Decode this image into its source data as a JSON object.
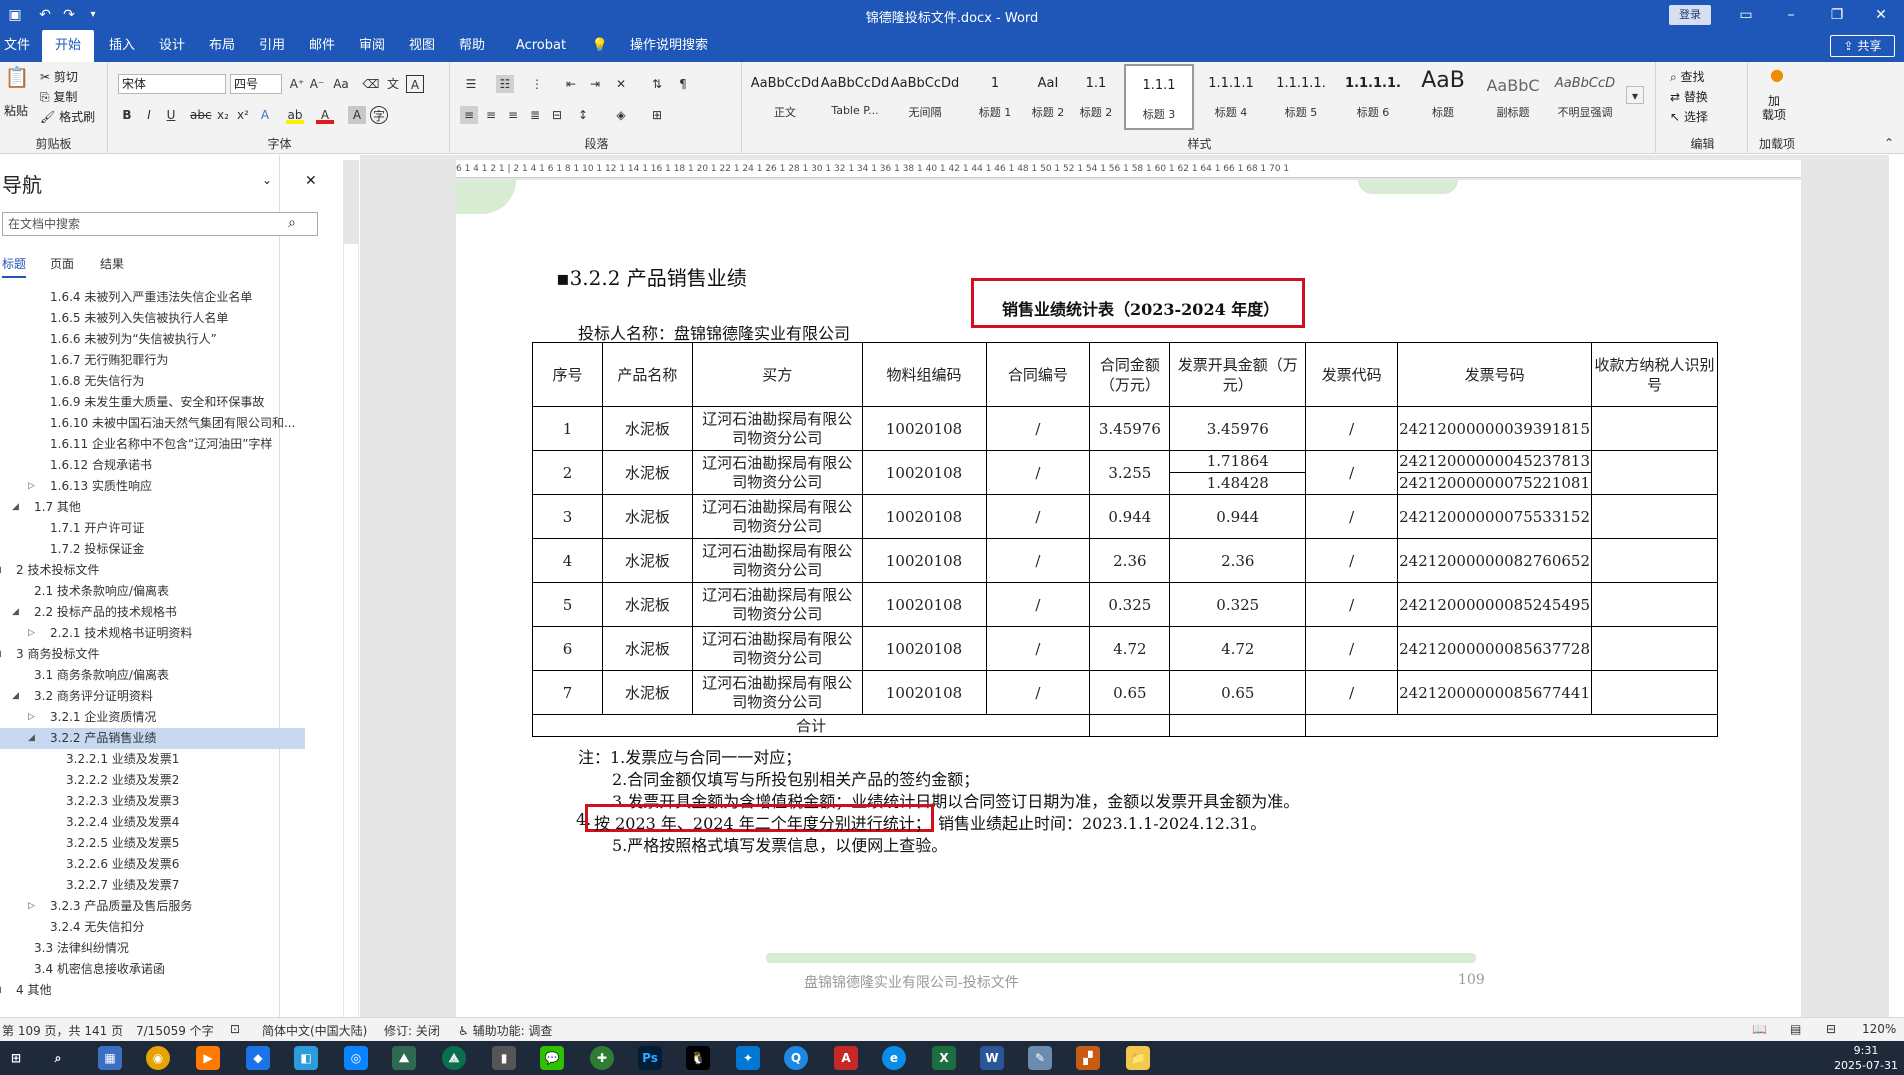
{
  "window": {
    "title": "锦德隆投标文件.docx - Word",
    "login": "登录"
  },
  "menu": {
    "tabs": [
      "文件",
      "开始",
      "插入",
      "设计",
      "布局",
      "引用",
      "邮件",
      "审阅",
      "视图",
      "帮助",
      "Acrobat",
      "操作说明搜索"
    ],
    "share": "共享"
  },
  "ribbon": {
    "clipboard": {
      "paste": "粘贴",
      "cut": "剪切",
      "copy": "复制",
      "format_painter": "格式刷",
      "label": "剪贴板"
    },
    "font": {
      "name": "宋体",
      "size": "四号",
      "label": "字体"
    },
    "paragraph": {
      "label": "段落"
    },
    "styles": {
      "label": "样式",
      "items": [
        {
          "preview": "AaBbCcDd",
          "name": "正文"
        },
        {
          "preview": "AaBbCcDd",
          "name": "Table P..."
        },
        {
          "preview": "AaBbCcDd",
          "name": "无间隔"
        },
        {
          "preview": "1",
          "name": "标题 1"
        },
        {
          "preview": "AaI",
          "name": "标题 2"
        },
        {
          "preview": "1.1",
          "name": "标题 2"
        },
        {
          "preview": "1.1.1",
          "name": "标题 3"
        },
        {
          "preview": "1.1.1.1",
          "name": "标题 4"
        },
        {
          "preview": "1.1.1.1.",
          "name": "标题 5"
        },
        {
          "preview": "1.1.1.1.",
          "name": "标题 6"
        },
        {
          "preview": "AaB",
          "name": "标题"
        },
        {
          "preview": "AaBbC",
          "name": "副标题"
        },
        {
          "preview": "AaBbCcD",
          "name": "不明显强调"
        }
      ]
    },
    "editing": {
      "find": "查找",
      "replace": "替换",
      "select": "选择",
      "label": "编辑"
    },
    "addins": {
      "button": "加\n载项",
      "label": "加载项"
    }
  },
  "nav": {
    "title": "导航",
    "search_placeholder": "在文档中搜索",
    "tabs": [
      "标题",
      "页面",
      "结果"
    ],
    "items": [
      {
        "text": "1.6.4 未被列入严重违法失信企业名单",
        "level": 3
      },
      {
        "text": "1.6.5 未被列入失信被执行人名单",
        "level": 3
      },
      {
        "text": "1.6.6 未被列为“失信被执行人”",
        "level": 3
      },
      {
        "text": "1.6.7 无行贿犯罪行为",
        "level": 3
      },
      {
        "text": "1.6.8 无失信行为",
        "level": 3
      },
      {
        "text": "1.6.9 未发生重大质量、安全和环保事故",
        "level": 3
      },
      {
        "text": "1.6.10 未被中国石油天然气集团有限公司和...",
        "level": 3
      },
      {
        "text": "1.6.11 企业名称中不包含“辽河油田”字样",
        "level": 3
      },
      {
        "text": "1.6.12 合规承诺书",
        "level": 3
      },
      {
        "text": "1.6.13 实质性响应",
        "level": 3,
        "arrow": "▷"
      },
      {
        "text": "1.7 其他",
        "level": 2,
        "arrow": "◢"
      },
      {
        "text": "1.7.1 开户许可证",
        "level": 3
      },
      {
        "text": "1.7.2 投标保证金",
        "level": 3
      },
      {
        "text": "2 技术投标文件",
        "level": 1,
        "arrow": "◢"
      },
      {
        "text": "2.1 技术条款响应/偏离表",
        "level": 2
      },
      {
        "text": "2.2 投标产品的技术规格书",
        "level": 2,
        "arrow": "◢"
      },
      {
        "text": "2.2.1 技术规格书证明资料",
        "level": 3,
        "arrow": "▷"
      },
      {
        "text": "3 商务投标文件",
        "level": 1,
        "arrow": "◢"
      },
      {
        "text": "3.1 商务条款响应/偏离表",
        "level": 2
      },
      {
        "text": "3.2 商务评分证明资料",
        "level": 2,
        "arrow": "◢"
      },
      {
        "text": "3.2.1 企业资质情况",
        "level": 3,
        "arrow": "▷"
      },
      {
        "text": "3.2.2 产品销售业绩",
        "level": 3,
        "arrow": "◢",
        "selected": true
      },
      {
        "text": "3.2.2.1 业绩及发票1",
        "level": 4
      },
      {
        "text": "3.2.2.2 业绩及发票2",
        "level": 4
      },
      {
        "text": "3.2.2.3 业绩及发票3",
        "level": 4
      },
      {
        "text": "3.2.2.4 业绩及发票4",
        "level": 4
      },
      {
        "text": "3.2.2.5 业绩及发票5",
        "level": 4
      },
      {
        "text": "3.2.2.6 业绩及发票6",
        "level": 4
      },
      {
        "text": "3.2.2.7 业绩及发票7",
        "level": 4
      },
      {
        "text": "3.2.3 产品质量及售后服务",
        "level": 3,
        "arrow": "▷"
      },
      {
        "text": "3.2.4 无失信扣分",
        "level": 3
      },
      {
        "text": "3.3 法律纠纷情况",
        "level": 2
      },
      {
        "text": "3.4 机密信息接收承诺函",
        "level": 2
      },
      {
        "text": "4 其他",
        "level": 1,
        "arrow": "◢"
      }
    ]
  },
  "ruler_text": "6 1 4 1 2 1 | 2 1 4 1 6 1 8 1 10 1 12 1 14 1 16 1 18 1 20 1 22 1 24 1 26 1 28 1 30 1 32 1 34 1 36 1 38 1 40 1 42 1 44 1 46 1 48 1 50 1 52 1 54 1 56 1 58 1 60 1 62 1 64 1 66 1 68 1 70 1",
  "vruler_text": "2 1 2 1 4 1 6 1 8 1 10 1 12 1 14 1 16 1 18 1 20 1 22 1 24 1 26 1 28 1 30",
  "doc": {
    "heading": "3.2.2 产品销售业绩",
    "table_title": "销售业绩统计表（2023-2024 年度）",
    "bidder": "投标人名称：盘锦锦德隆实业有限公司",
    "headers": [
      "序号",
      "产品名称",
      "买方",
      "物料组编码",
      "合同编号",
      "合同金额（万元）",
      "发票开具金额（万元）",
      "发票代码",
      "发票号码",
      "收款方纳税人识别号"
    ],
    "rows": [
      {
        "no": "1",
        "product": "水泥板",
        "buyer": "辽河石油勘探局有限公司物资分公司",
        "code": "10020108",
        "contract": "/",
        "amount": "3.45976",
        "invoice_amounts": [
          "3.45976"
        ],
        "inv_code": "/",
        "inv_numbers": [
          "24212000000039391815"
        ],
        "taxid": ""
      },
      {
        "no": "2",
        "product": "水泥板",
        "buyer": "辽河石油勘探局有限公司物资分公司",
        "code": "10020108",
        "contract": "/",
        "amount": "3.255",
        "invoice_amounts": [
          "1.71864",
          "1.48428"
        ],
        "inv_code": "/",
        "inv_numbers": [
          "24212000000045237813",
          "24212000000075221081"
        ],
        "taxid": ""
      },
      {
        "no": "3",
        "product": "水泥板",
        "buyer": "辽河石油勘探局有限公司物资分公司",
        "code": "10020108",
        "contract": "/",
        "amount": "0.944",
        "invoice_amounts": [
          "0.944"
        ],
        "inv_code": "/",
        "inv_numbers": [
          "24212000000075533152"
        ],
        "taxid": ""
      },
      {
        "no": "4",
        "product": "水泥板",
        "buyer": "辽河石油勘探局有限公司物资分公司",
        "code": "10020108",
        "contract": "/",
        "amount": "2.36",
        "invoice_amounts": [
          "2.36"
        ],
        "inv_code": "/",
        "inv_numbers": [
          "24212000000082760652"
        ],
        "taxid": ""
      },
      {
        "no": "5",
        "product": "水泥板",
        "buyer": "辽河石油勘探局有限公司物资分公司",
        "code": "10020108",
        "contract": "/",
        "amount": "0.325",
        "invoice_amounts": [
          "0.325"
        ],
        "inv_code": "/",
        "inv_numbers": [
          "24212000000085245495"
        ],
        "taxid": ""
      },
      {
        "no": "6",
        "product": "水泥板",
        "buyer": "辽河石油勘探局有限公司物资分公司",
        "code": "10020108",
        "contract": "/",
        "amount": "4.72",
        "invoice_amounts": [
          "4.72"
        ],
        "inv_code": "/",
        "inv_numbers": [
          "24212000000085637728"
        ],
        "taxid": ""
      },
      {
        "no": "7",
        "product": "水泥板",
        "buyer": "辽河石油勘探局有限公司物资分公司",
        "code": "10020108",
        "contract": "/",
        "amount": "0.65",
        "invoice_amounts": [
          "0.65"
        ],
        "inv_code": "/",
        "inv_numbers": [
          "24212000000085677441"
        ],
        "taxid": ""
      }
    ],
    "total_label": "合计",
    "notes": [
      "注：1.发票应与合同一一对应；",
      "2.合同金额仅填写与所投包别相关产品的签约金额；",
      "3.发票开具金额为含增值税金额；业绩统计日期以合同签订日期为准，金额以发票开具金额为准。",
      "按 2023 年、2024 年二个年度分别进行统计；",
      "销售业绩起止时间：2023.1.1-2024.12.31。",
      "5.严格按照格式填写发票信息，以便网上查验。"
    ],
    "note4_prefix": "4.",
    "footer": "盘锦锦德隆实业有限公司-投标文件",
    "page_number": "109"
  },
  "status": {
    "page": "第 109 页，共 141 页",
    "words": "7/15059 个字",
    "language": "简体中文(中国大陆)",
    "track": "修订: 关闭",
    "accessibility": "辅助功能: 调查",
    "zoom": "120%"
  },
  "clock": {
    "time": "9:31",
    "date": "2025-07-31"
  },
  "colors": {
    "word_blue": "#1f57b8",
    "highlight_red": "#d0101e",
    "nav_selected": "#c6d9f1"
  }
}
